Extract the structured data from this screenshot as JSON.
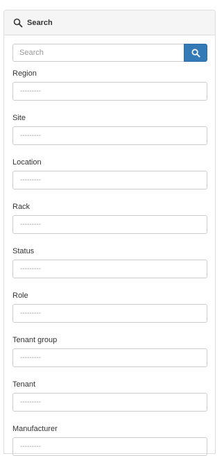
{
  "panel": {
    "title": "Search",
    "icon": "search-icon"
  },
  "search": {
    "placeholder": "Search",
    "value": "",
    "button_icon": "search-icon",
    "button_color": "#337ab7"
  },
  "fields": [
    {
      "label": "Region",
      "value": "---------"
    },
    {
      "label": "Site",
      "value": "---------"
    },
    {
      "label": "Location",
      "value": "---------"
    },
    {
      "label": "Rack",
      "value": "---------"
    },
    {
      "label": "Status",
      "value": "---------"
    },
    {
      "label": "Role",
      "value": "---------"
    },
    {
      "label": "Tenant group",
      "value": "---------"
    },
    {
      "label": "Tenant",
      "value": "---------"
    },
    {
      "label": "Manufacturer",
      "value": "---------"
    }
  ]
}
